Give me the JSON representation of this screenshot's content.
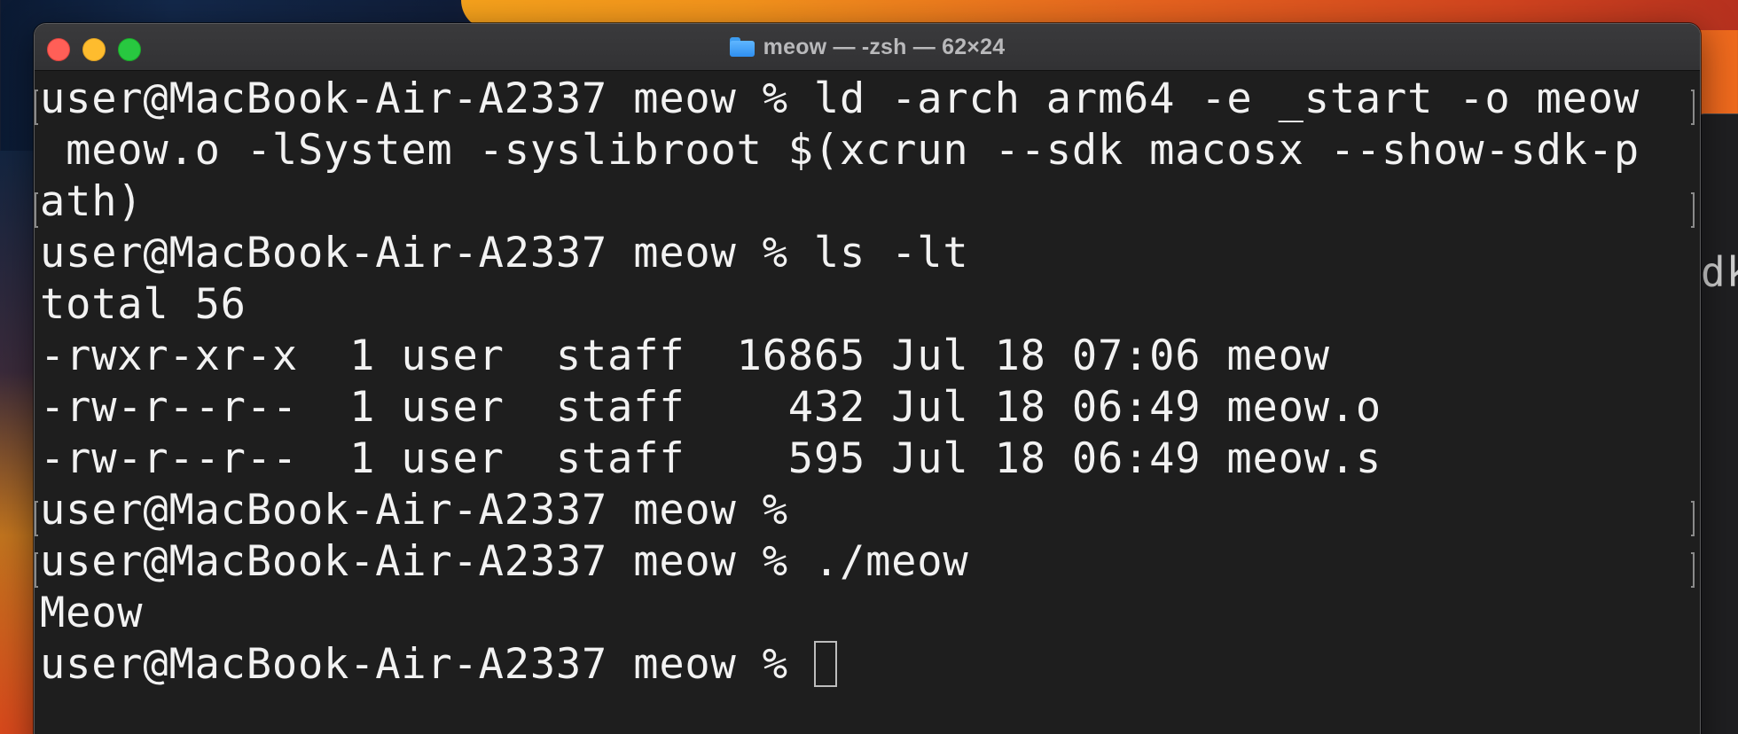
{
  "window": {
    "title": "meow — -zsh — 62×24",
    "folder_icon": "folder-icon",
    "controls": [
      "close-button",
      "minimize-button",
      "zoom-button"
    ]
  },
  "terminal": {
    "lines": [
      "user@MacBook-Air-A2337 meow % ld -arch arm64 -e _start -o meow",
      " meow.o -lSystem -syslibroot $(xcrun --sdk macosx --show-sdk-p",
      "ath)",
      "user@MacBook-Air-A2337 meow % ls -lt",
      "total 56",
      "-rwxr-xr-x  1 user  staff  16865 Jul 18 07:06 meow",
      "-rw-r--r--  1 user  staff    432 Jul 18 06:49 meow.o",
      "-rw-r--r--  1 user  staff    595 Jul 18 06:49 meow.s",
      "user@MacBook-Air-A2337 meow %",
      "user@MacBook-Air-A2337 meow % ./meow",
      "Meow",
      "user@MacBook-Air-A2337 meow % "
    ]
  },
  "background_window": {
    "visible_text": "dk"
  },
  "colors": {
    "terminal_bg": "#1e1e1e",
    "terminal_fg": "#f2f2f2",
    "close": "#ff5f57",
    "minimize": "#febc2e",
    "zoom": "#28c840"
  }
}
